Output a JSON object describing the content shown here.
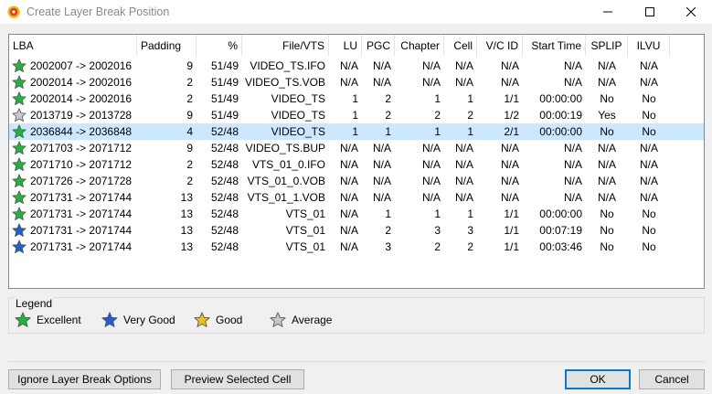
{
  "window": {
    "title": "Create Layer Break Position"
  },
  "columns": [
    "LBA",
    "Padding",
    "%",
    "File/VTS",
    "LU",
    "PGC",
    "Chapter",
    "Cell",
    "V/C ID",
    "Start Time",
    "SPLIP",
    "ILVU"
  ],
  "rows": [
    {
      "star": "green",
      "lba": "2002007 -> 2002016",
      "padding": "9",
      "pct": "51/49",
      "file": "VIDEO_TS.IFO",
      "lu": "N/A",
      "pgc": "N/A",
      "chapter": "N/A",
      "cell": "N/A",
      "vcid": "N/A",
      "start": "N/A",
      "splip": "N/A",
      "ilvu": "N/A"
    },
    {
      "star": "green",
      "lba": "2002014 -> 2002016",
      "padding": "2",
      "pct": "51/49",
      "file": "VIDEO_TS.VOB",
      "lu": "N/A",
      "pgc": "N/A",
      "chapter": "N/A",
      "cell": "N/A",
      "vcid": "N/A",
      "start": "N/A",
      "splip": "N/A",
      "ilvu": "N/A"
    },
    {
      "star": "green",
      "lba": "2002014 -> 2002016",
      "padding": "2",
      "pct": "51/49",
      "file": "VIDEO_TS",
      "lu": "1",
      "pgc": "2",
      "chapter": "1",
      "cell": "1",
      "vcid": "1/1",
      "start": "00:00:00",
      "splip": "No",
      "ilvu": "No"
    },
    {
      "star": "gray",
      "lba": "2013719 -> 2013728",
      "padding": "9",
      "pct": "51/49",
      "file": "VIDEO_TS",
      "lu": "1",
      "pgc": "2",
      "chapter": "2",
      "cell": "2",
      "vcid": "1/2",
      "start": "00:00:19",
      "splip": "Yes",
      "ilvu": "No"
    },
    {
      "star": "green",
      "lba": "2036844 -> 2036848",
      "padding": "4",
      "pct": "52/48",
      "file": "VIDEO_TS",
      "lu": "1",
      "pgc": "1",
      "chapter": "1",
      "cell": "1",
      "vcid": "2/1",
      "start": "00:00:00",
      "splip": "No",
      "ilvu": "No",
      "selected": true
    },
    {
      "star": "green",
      "lba": "2071703 -> 2071712",
      "padding": "9",
      "pct": "52/48",
      "file": "VIDEO_TS.BUP",
      "lu": "N/A",
      "pgc": "N/A",
      "chapter": "N/A",
      "cell": "N/A",
      "vcid": "N/A",
      "start": "N/A",
      "splip": "N/A",
      "ilvu": "N/A"
    },
    {
      "star": "green",
      "lba": "2071710 -> 2071712",
      "padding": "2",
      "pct": "52/48",
      "file": "VTS_01_0.IFO",
      "lu": "N/A",
      "pgc": "N/A",
      "chapter": "N/A",
      "cell": "N/A",
      "vcid": "N/A",
      "start": "N/A",
      "splip": "N/A",
      "ilvu": "N/A"
    },
    {
      "star": "green",
      "lba": "2071726 -> 2071728",
      "padding": "2",
      "pct": "52/48",
      "file": "VTS_01_0.VOB",
      "lu": "N/A",
      "pgc": "N/A",
      "chapter": "N/A",
      "cell": "N/A",
      "vcid": "N/A",
      "start": "N/A",
      "splip": "N/A",
      "ilvu": "N/A"
    },
    {
      "star": "green",
      "lba": "2071731 -> 2071744",
      "padding": "13",
      "pct": "52/48",
      "file": "VTS_01_1.VOB",
      "lu": "N/A",
      "pgc": "N/A",
      "chapter": "N/A",
      "cell": "N/A",
      "vcid": "N/A",
      "start": "N/A",
      "splip": "N/A",
      "ilvu": "N/A"
    },
    {
      "star": "green",
      "lba": "2071731 -> 2071744",
      "padding": "13",
      "pct": "52/48",
      "file": "VTS_01",
      "lu": "N/A",
      "pgc": "1",
      "chapter": "1",
      "cell": "1",
      "vcid": "1/1",
      "start": "00:00:00",
      "splip": "No",
      "ilvu": "No"
    },
    {
      "star": "blue",
      "lba": "2071731 -> 2071744",
      "padding": "13",
      "pct": "52/48",
      "file": "VTS_01",
      "lu": "N/A",
      "pgc": "2",
      "chapter": "3",
      "cell": "3",
      "vcid": "1/1",
      "start": "00:07:19",
      "splip": "No",
      "ilvu": "No"
    },
    {
      "star": "blue",
      "lba": "2071731 -> 2071744",
      "padding": "13",
      "pct": "52/48",
      "file": "VTS_01",
      "lu": "N/A",
      "pgc": "3",
      "chapter": "2",
      "cell": "2",
      "vcid": "1/1",
      "start": "00:03:46",
      "splip": "No",
      "ilvu": "No"
    }
  ],
  "legend": {
    "title": "Legend",
    "items": [
      {
        "color": "green",
        "label": "Excellent"
      },
      {
        "color": "blue",
        "label": "Very Good"
      },
      {
        "color": "yellow",
        "label": "Good"
      },
      {
        "color": "gray",
        "label": "Average"
      }
    ]
  },
  "buttons": {
    "ignore": "Ignore Layer Break Options",
    "preview": "Preview Selected Cell",
    "ok": "OK",
    "cancel": "Cancel"
  },
  "colors": {
    "green": "#22b43a",
    "blue": "#1f5fd6",
    "yellow": "#e8c21a",
    "gray": "#c8c8c8",
    "selection": "#cce8ff",
    "accent": "#0078d7"
  }
}
